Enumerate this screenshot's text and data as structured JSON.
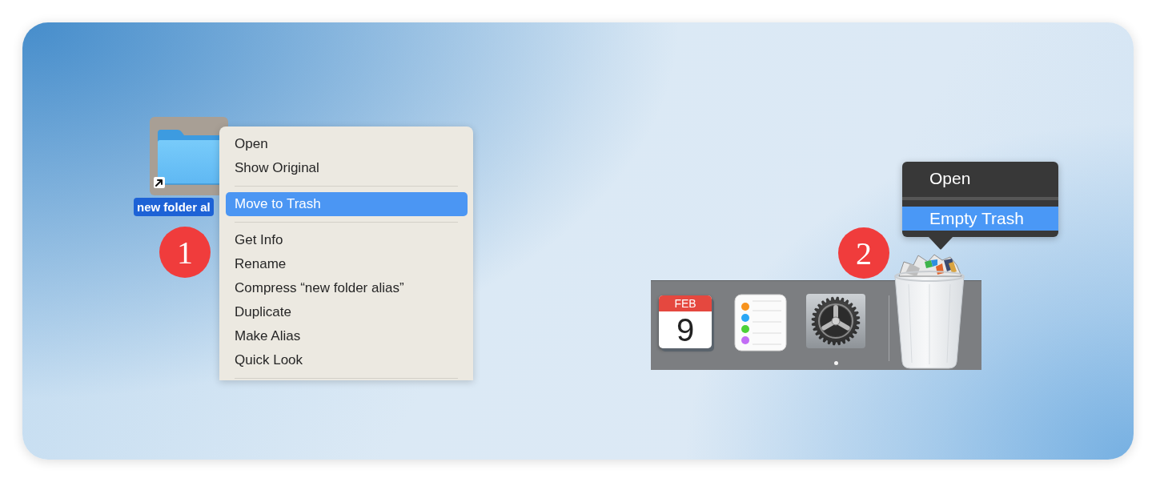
{
  "desktop": {
    "item": {
      "label": "new folder al",
      "selected": true,
      "alias": true
    },
    "step_badge": "1"
  },
  "context_menu": {
    "items": [
      {
        "kind": "item",
        "label": "Open",
        "selected": false
      },
      {
        "kind": "item",
        "label": "Show Original",
        "selected": false
      },
      {
        "kind": "separator"
      },
      {
        "kind": "item",
        "label": "Move to Trash",
        "selected": true
      },
      {
        "kind": "separator"
      },
      {
        "kind": "item",
        "label": "Get Info",
        "selected": false
      },
      {
        "kind": "item",
        "label": "Rename",
        "selected": false
      },
      {
        "kind": "item",
        "label": "Compress “new folder alias”",
        "selected": false
      },
      {
        "kind": "item",
        "label": "Duplicate",
        "selected": false
      },
      {
        "kind": "item",
        "label": "Make Alias",
        "selected": false
      },
      {
        "kind": "item",
        "label": "Quick Look",
        "selected": false
      },
      {
        "kind": "separator"
      }
    ]
  },
  "dock": {
    "apps": [
      {
        "kind": "calendar",
        "month": "FEB",
        "day": "9",
        "running": false
      },
      {
        "kind": "reminders",
        "running": false
      },
      {
        "kind": "settings",
        "running": true
      }
    ],
    "trash": {
      "step_badge": "2",
      "menu": {
        "items": [
          {
            "kind": "item",
            "label": "Open",
            "selected": false
          },
          {
            "kind": "separator"
          },
          {
            "kind": "item",
            "label": "Empty Trash",
            "selected": true
          }
        ]
      }
    }
  }
}
